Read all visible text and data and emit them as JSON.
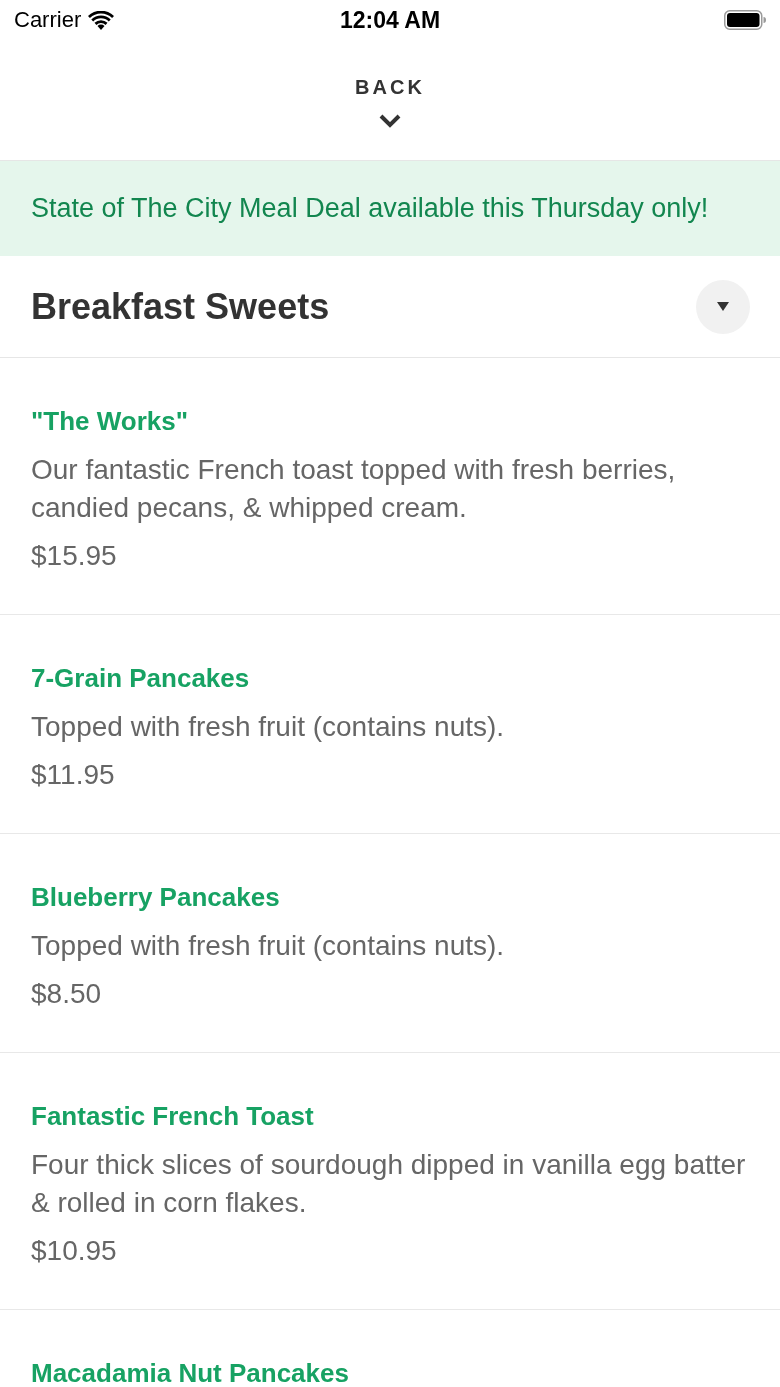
{
  "status_bar": {
    "carrier": "Carrier",
    "time": "12:04 AM"
  },
  "header": {
    "back_label": "BACK"
  },
  "banner": {
    "text": "State of The City Meal Deal available this Thursday only!"
  },
  "section": {
    "title": "Breakfast Sweets"
  },
  "items": [
    {
      "name": "\"The Works\"",
      "description": "Our fantastic French toast topped with fresh berries, candied pecans, & whipped cream.",
      "price": "$15.95"
    },
    {
      "name": "7-Grain Pancakes",
      "description": "Topped with fresh fruit (contains nuts).",
      "price": "$11.95"
    },
    {
      "name": "Blueberry Pancakes",
      "description": "Topped with fresh fruit (contains nuts).",
      "price": "$8.50"
    },
    {
      "name": "Fantastic French Toast",
      "description": "Four thick slices of sourdough dipped in vanilla egg batter & rolled in corn flakes.",
      "price": "$10.95"
    },
    {
      "name": "Macadamia Nut Pancakes"
    }
  ]
}
